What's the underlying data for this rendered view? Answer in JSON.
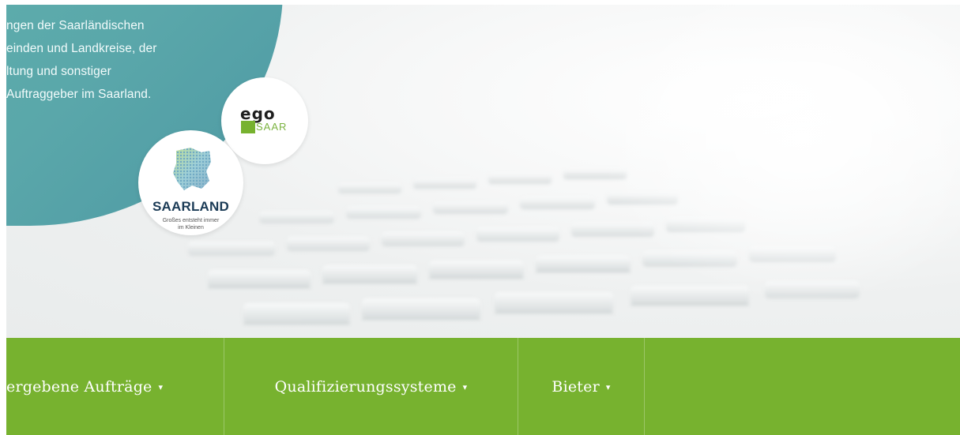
{
  "hero": {
    "intro_lines": [
      "ngen der Saarländischen",
      "einden und Landkreise, der",
      "ltung und sonstiger",
      "Auftraggeber im Saarland."
    ]
  },
  "logos": {
    "ego": {
      "word": "ego",
      "saar": "SAAR",
      "icon": "ego-saar-logo"
    },
    "saarland": {
      "name": "SAARLAND",
      "tagline_line1": "Großes entsteht immer",
      "tagline_line2": "im Kleinen",
      "icon": "saarland-map-icon"
    }
  },
  "nav": {
    "items": [
      {
        "label": "ergebene Aufträge",
        "caret": "▾"
      },
      {
        "label": "Qualifizierungssysteme",
        "caret": "▾"
      },
      {
        "label": "Bieter",
        "caret": "▾"
      }
    ]
  },
  "colors": {
    "nav_green": "#77b22f",
    "teal": "#5aa7aa",
    "brand_navy": "#1b3b56"
  }
}
